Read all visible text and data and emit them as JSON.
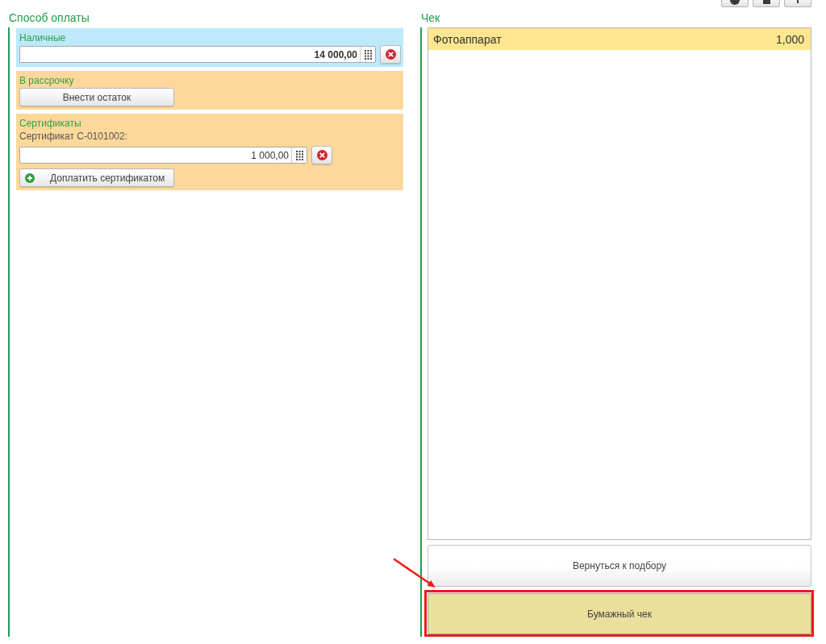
{
  "payment": {
    "title": "Способ оплаты",
    "groups": [
      {
        "kind": "cash",
        "label": "Наличные",
        "color": "#bde9fb",
        "items": [
          {
            "kind": "amount",
            "value": "14 000,00",
            "bold": true
          }
        ]
      },
      {
        "kind": "installment",
        "label": "В рассрочку",
        "color": "#fed89b",
        "items": [
          {
            "kind": "button",
            "text": "Внести остаток"
          }
        ]
      },
      {
        "kind": "certificates",
        "label": "Сертификаты",
        "color": "#fed89b",
        "items": [
          {
            "kind": "caption",
            "text": "Сертификат С-0101002:"
          },
          {
            "kind": "amount",
            "value": "1 000,00",
            "bold": false
          },
          {
            "kind": "add-button",
            "text": "Доплатить сертификатом"
          }
        ]
      }
    ]
  },
  "receipt": {
    "title": "Чек",
    "rows": [
      {
        "name": "Фотоаппарат",
        "quantity": "1,000",
        "selected": true
      }
    ],
    "buttons": [
      {
        "kind": "plain",
        "label": "Вернуться к подбору",
        "highlighted": false
      },
      {
        "kind": "accent",
        "label": "Бумажный чек",
        "highlighted": true
      }
    ]
  }
}
